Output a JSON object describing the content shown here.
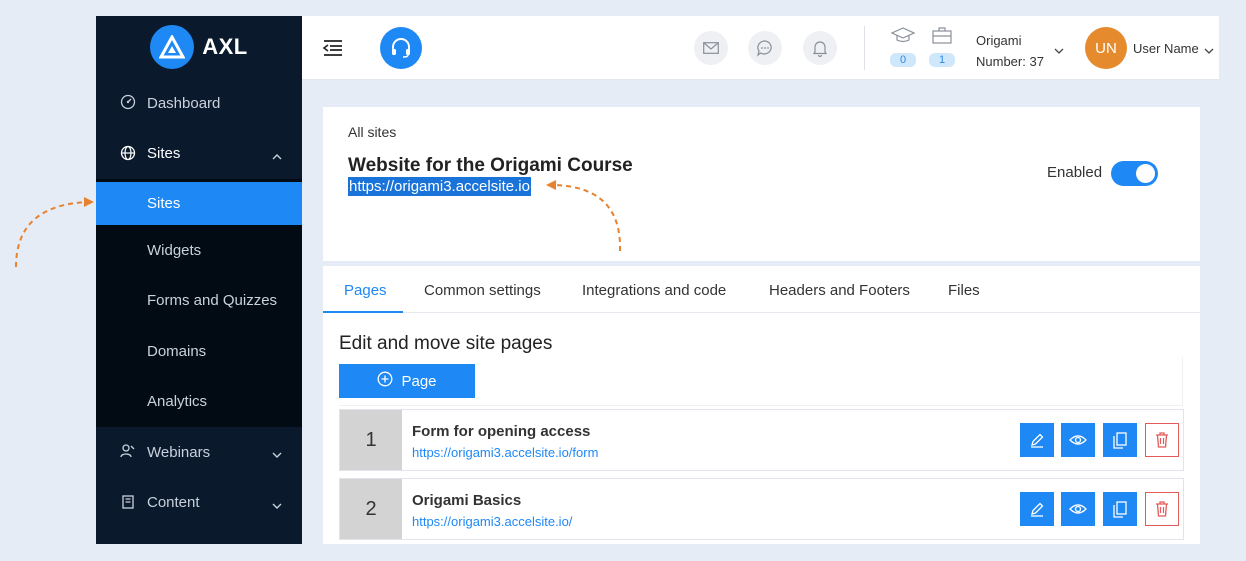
{
  "brand": {
    "name": "AXL"
  },
  "sidebar": {
    "items": [
      {
        "label": "Dashboard",
        "icon": "dashboard-icon"
      },
      {
        "label": "Sites",
        "icon": "globe-icon",
        "expanded": true
      },
      {
        "label": "Webinars",
        "icon": "webinar-icon"
      },
      {
        "label": "Content",
        "icon": "book-icon"
      }
    ],
    "sites_sub": [
      "Sites",
      "Widgets",
      "Forms and Quizzes",
      "Domains",
      "Analytics"
    ],
    "active_sub": "Sites"
  },
  "topbar": {
    "courses_count": "0",
    "portfolio_count": "1",
    "org_name": "Origami",
    "org_number": "Number: 37",
    "avatar_initials": "UN",
    "user_name": "User Name"
  },
  "site": {
    "breadcrumb": "All sites",
    "title": "Website for the Origami Course",
    "url": "https://origami3.accelsite.io",
    "enabled_label": "Enabled",
    "enabled": true
  },
  "tabs": [
    "Pages",
    "Common settings",
    "Integrations and code",
    "Headers and Footers",
    "Files"
  ],
  "active_tab": "Pages",
  "pages_section": {
    "title": "Edit and move site pages",
    "add_label": "Page",
    "rows": [
      {
        "num": "1",
        "title": "Form for opening access",
        "url": "https://origami3.accelsite.io/form"
      },
      {
        "num": "2",
        "title": "Origami Basics",
        "url": "https://origami3.accelsite.io/"
      }
    ]
  },
  "colors": {
    "accent": "#1e88f5",
    "sidebar_bg": "#0a1a2c",
    "annotation_arrow": "#e8822e",
    "delete": "#e35a5a"
  }
}
